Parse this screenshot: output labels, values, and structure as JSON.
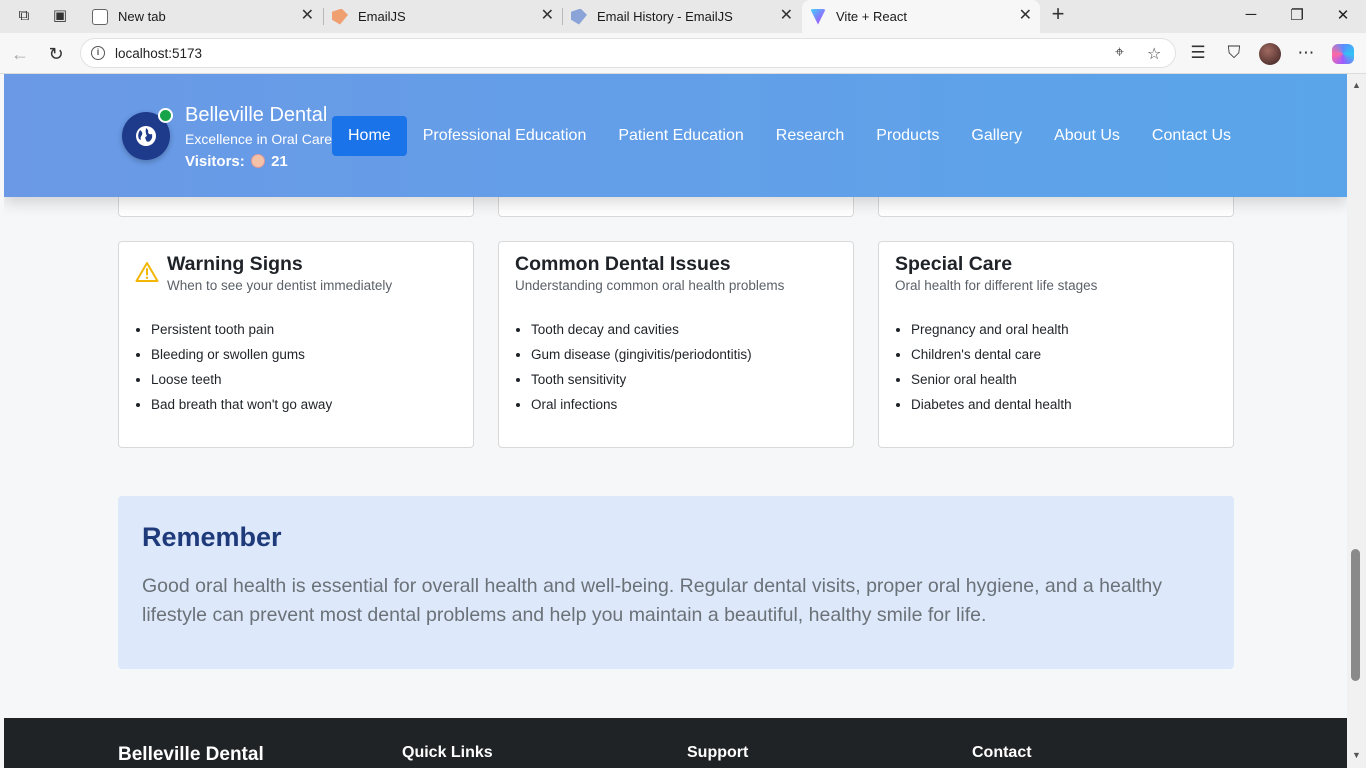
{
  "browser": {
    "tabs": [
      {
        "label": "New tab",
        "favicon": "new-tab-icon",
        "active": false
      },
      {
        "label": "EmailJS",
        "favicon": "emailjs-icon",
        "active": false
      },
      {
        "label": "Email History - EmailJS",
        "favicon": "emailjs-icon",
        "active": false
      },
      {
        "label": "Vite + React",
        "favicon": "vite-icon",
        "active": true
      }
    ],
    "url": "localhost:5173"
  },
  "header": {
    "brand_name": "Belleville Dental",
    "tagline": "Excellence in Oral Care",
    "visitors_label": "Visitors:",
    "visitors_count": "21",
    "nav": [
      {
        "label": "Home",
        "active": true
      },
      {
        "label": "Professional Education"
      },
      {
        "label": "Patient Education"
      },
      {
        "label": "Research"
      },
      {
        "label": "Products"
      },
      {
        "label": "Gallery"
      },
      {
        "label": "About Us"
      },
      {
        "label": "Contact Us"
      }
    ],
    "accent_color": "#1a73e8",
    "online_color": "#16a34a"
  },
  "cards": [
    {
      "title": "Warning Signs",
      "subtitle": "When to see your dentist immediately",
      "icon": "warning-icon",
      "items": [
        "Persistent tooth pain",
        "Bleeding or swollen gums",
        "Loose teeth",
        "Bad breath that won't go away"
      ]
    },
    {
      "title": "Common Dental Issues",
      "subtitle": "Understanding common oral health problems",
      "items": [
        "Tooth decay and cavities",
        "Gum disease (gingivitis/periodontitis)",
        "Tooth sensitivity",
        "Oral infections"
      ]
    },
    {
      "title": "Special Care",
      "subtitle": "Oral health for different life stages",
      "items": [
        "Pregnancy and oral health",
        "Children's dental care",
        "Senior oral health",
        "Diabetes and dental health"
      ]
    }
  ],
  "remember": {
    "title": "Remember",
    "text": "Good oral health is essential for overall health and well-being. Regular dental visits, proper oral hygiene, and a healthy lifestyle can prevent most dental problems and help you maintain a beautiful, healthy smile for life."
  },
  "footer": {
    "brand": "Belleville Dental",
    "quick_links": "Quick Links",
    "support": "Support",
    "contact": "Contact"
  }
}
